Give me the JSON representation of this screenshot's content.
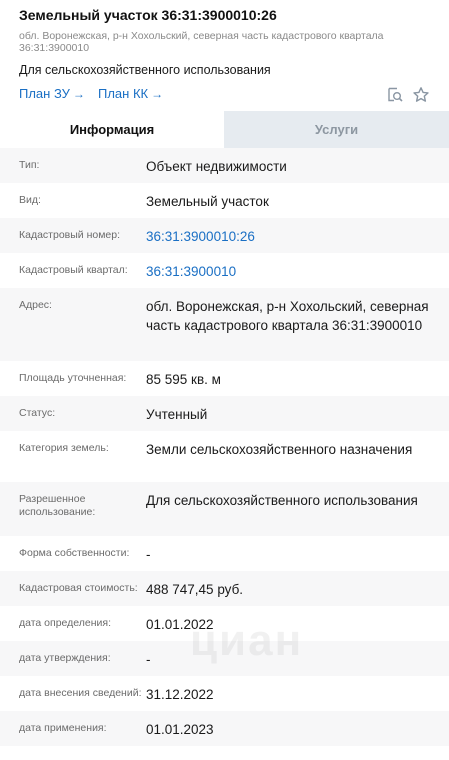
{
  "header": {
    "title": "Земельный участок 36:31:3900010:26",
    "address": "обл. Воронежская, р-н Хохольский, северная часть кадастрового квартала 36:31:3900010",
    "purpose": "Для сельскохозяйственного использования",
    "links": [
      {
        "label": "План ЗУ",
        "arrow": "→"
      },
      {
        "label": "План КК",
        "arrow": "→"
      }
    ],
    "icons": [
      "search-document-icon",
      "star-icon"
    ]
  },
  "tabs": [
    {
      "label": "Информация",
      "active": true
    },
    {
      "label": "Услуги",
      "active": false
    }
  ],
  "rows": [
    {
      "label": "Тип:",
      "value": "Объект недвижимости"
    },
    {
      "label": "Вид:",
      "value": "Земельный участок"
    },
    {
      "label": "Кадастровый номер:",
      "value": "36:31:3900010:26",
      "link": true
    },
    {
      "label": "Кадастровый квартал:",
      "value": "36:31:3900010",
      "link": true
    },
    {
      "label": "Адрес:",
      "value": "обл. Воронежская, р-н Хохольский, северная часть кадастрового квартала 36:31:3900010"
    },
    {
      "label": "Площадь уточненная:",
      "value": "85 595 кв. м"
    },
    {
      "label": "Статус:",
      "value": "Учтенный"
    },
    {
      "label": "Категория земель:",
      "value": "Земли сельскохозяйственного назначения"
    },
    {
      "label": "Разрешенное использование:",
      "value": "Для сельскохозяйственного использования"
    },
    {
      "label": "Форма собственности:",
      "value": "-"
    },
    {
      "label": "Кадастровая стоимость:",
      "value": "488 747,45 руб."
    },
    {
      "label": "дата определения:",
      "value": "01.01.2022"
    },
    {
      "label": "дата утверждения:",
      "value": "-"
    },
    {
      "label": "дата внесения сведений:",
      "value": "31.12.2022"
    },
    {
      "label": "дата применения:",
      "value": "01.01.2023"
    }
  ],
  "watermark": "циан",
  "colors": {
    "link": "#1a6fc4",
    "tab_inactive_bg": "#e6ebf0",
    "row_alt_bg": "#f7f7f8"
  }
}
